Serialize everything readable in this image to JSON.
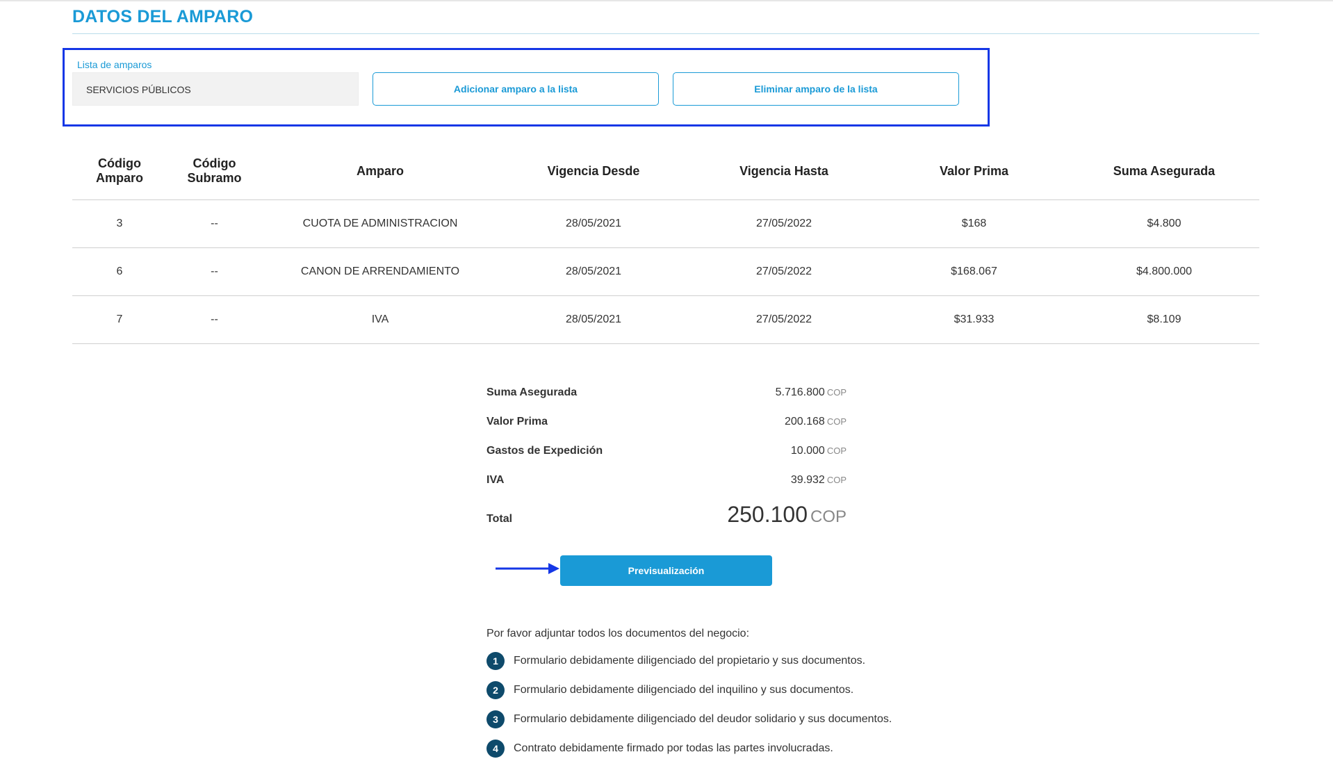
{
  "section": {
    "title": "DATOS DEL AMPARO"
  },
  "amparo_list": {
    "label": "Lista de amparos",
    "selected": "SERVICIOS PÚBLICOS",
    "add_button": "Adicionar amparo a la lista",
    "remove_button": "Eliminar amparo de la lista"
  },
  "table": {
    "headers": [
      "Código Amparo",
      "Código Subramo",
      "Amparo",
      "Vigencia Desde",
      "Vigencia Hasta",
      "Valor Prima",
      "Suma Asegurada"
    ],
    "rows": [
      [
        "3",
        "--",
        "CUOTA DE ADMINISTRACION",
        "28/05/2021",
        "27/05/2022",
        "$168",
        "$4.800"
      ],
      [
        "6",
        "--",
        "CANON DE ARRENDAMIENTO",
        "28/05/2021",
        "27/05/2022",
        "$168.067",
        "$4.800.000"
      ],
      [
        "7",
        "--",
        "IVA",
        "28/05/2021",
        "27/05/2022",
        "$31.933",
        "$8.109"
      ]
    ]
  },
  "summary": {
    "currency": "COP",
    "items": [
      {
        "label": "Suma Asegurada",
        "value": "5.716.800"
      },
      {
        "label": "Valor Prima",
        "value": "200.168"
      },
      {
        "label": "Gastos de Expedición",
        "value": "10.000"
      },
      {
        "label": "IVA",
        "value": "39.932"
      }
    ],
    "total_label": "Total",
    "total_value": "250.100"
  },
  "preview_button": "Previsualización",
  "documents": {
    "intro": "Por favor adjuntar todos los documentos del negocio:",
    "items": [
      {
        "num": "1",
        "text": "Formulario debidamente diligenciado del propietario y sus documentos."
      },
      {
        "num": "2",
        "text": "Formulario debidamente diligenciado del inquilino y sus documentos."
      },
      {
        "num": "3",
        "text": "Formulario debidamente diligenciado del deudor solidario y sus documentos."
      },
      {
        "num": "4",
        "text": "Contrato debidamente firmado por todas las partes involucradas."
      }
    ]
  },
  "colors": {
    "accent": "#1a9ad6",
    "highlight": "#1537e6",
    "badge": "#0e4a6b"
  }
}
